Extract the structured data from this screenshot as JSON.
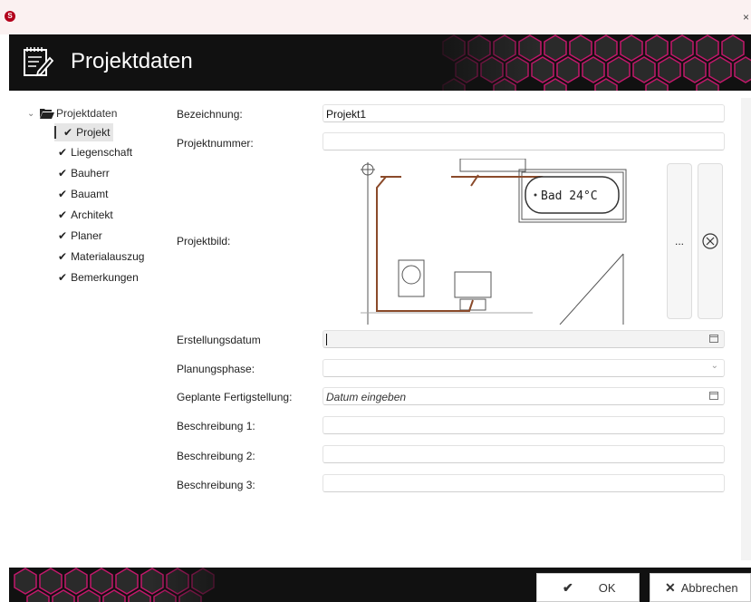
{
  "window": {
    "title": "Projektdaten",
    "close_glyph": "×",
    "app_icon_letter": "S"
  },
  "tree": {
    "root_label": "Projektdaten",
    "items": [
      {
        "label": "Projekt",
        "selected": true
      },
      {
        "label": "Liegenschaft"
      },
      {
        "label": "Bauherr"
      },
      {
        "label": "Bauamt"
      },
      {
        "label": "Architekt"
      },
      {
        "label": "Planer"
      },
      {
        "label": "Materialauszug"
      },
      {
        "label": "Bemerkungen"
      }
    ]
  },
  "form": {
    "bezeichnung": {
      "label": "Bezeichnung:",
      "value": "Projekt1"
    },
    "projektnummer": {
      "label": "Projektnummer:",
      "value": ""
    },
    "projektbild": {
      "label": "Projektbild:",
      "image_text": "Bad 24°C",
      "browse_label": "..."
    },
    "erstellungsdatum": {
      "label": "Erstellungsdatum",
      "value": ""
    },
    "planungsphase": {
      "label": "Planungsphase:",
      "value": ""
    },
    "fertigstellung": {
      "label": "Geplante Fertigstellung:",
      "placeholder": "Datum eingeben"
    },
    "beschreibung1": {
      "label": "Beschreibung 1:",
      "value": ""
    },
    "beschreibung2": {
      "label": "Beschreibung 2:",
      "value": ""
    },
    "beschreibung3": {
      "label": "Beschreibung 3:",
      "value": ""
    }
  },
  "buttons": {
    "ok": "OK",
    "cancel": "Abbrechen"
  },
  "colors": {
    "accent": "#b3001b",
    "header_bg": "#111111",
    "hex_glow": "#c2186b"
  }
}
